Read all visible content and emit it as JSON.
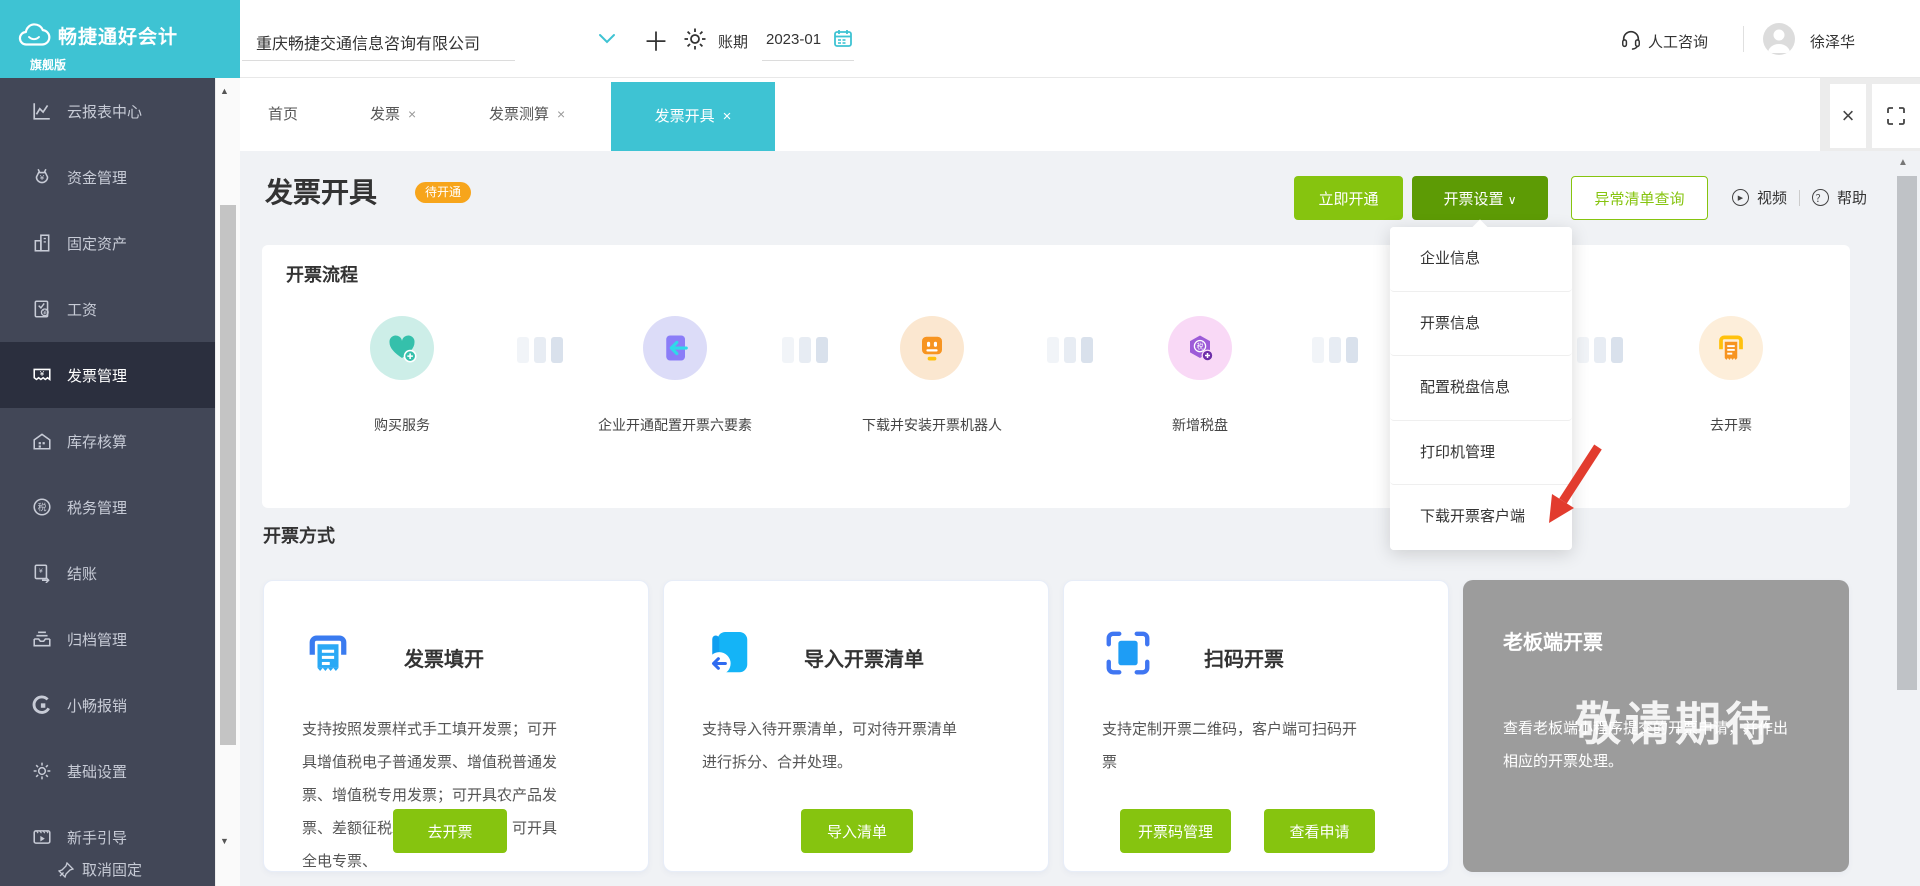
{
  "header": {
    "logo_title": "畅捷通好会计",
    "logo_subtitle": "旗舰版",
    "company": "重庆畅捷交通信息咨询有限公司",
    "period_label": "账期",
    "period_value": "2023-01",
    "support_label": "人工咨询",
    "username": "徐泽华"
  },
  "tabs": {
    "home": "首页",
    "invoice": "发票",
    "invoice_calc": "发票测算",
    "invoice_issue": "发票开具"
  },
  "page": {
    "title": "发票开具",
    "status_badge": "待开通",
    "actions": {
      "activate_now": "立即开通",
      "invoice_settings": "开票设置",
      "abnormal_list": "异常清单查询",
      "video": "视频",
      "help": "帮助"
    },
    "settings_menu": [
      "企业信息",
      "开票信息",
      "配置税盘信息",
      "打印机管理",
      "下载开票客户端"
    ]
  },
  "flow": {
    "heading": "开票流程",
    "steps": [
      "购买服务",
      "企业开通配置开票六要素",
      "下载并安装开票机器人",
      "新增税盘",
      "去开票"
    ]
  },
  "methods": {
    "heading": "开票方式",
    "cards": [
      {
        "title": "发票填开",
        "desc": "支持按照发票样式手工填开发票；可开具增值税电子普通发票、增值税普通发票、增值税专用发票；可开具农产品发票、差额征税发票、折扣发票；可开具全电专票、",
        "button": "去开票"
      },
      {
        "title": "导入开票清单",
        "desc": "支持导入待开票清单，可对待开票清单进行拆分、合并处理。",
        "button": "导入清单"
      },
      {
        "title": "扫码开票",
        "desc": "支持定制开票二维码，客户端可扫码开票",
        "buttons": [
          "开票码管理",
          "查看申请"
        ]
      },
      {
        "title": "老板端开票",
        "desc": "查看老板端小程序提交的开票申请，并作出相应的开票处理。",
        "watermark": "敬请期待"
      }
    ]
  },
  "sidebar": {
    "items": [
      "云报表中心",
      "资金管理",
      "固定资产",
      "工资",
      "发票管理",
      "库存核算",
      "税务管理",
      "结账",
      "归档管理",
      "小畅报销",
      "基础设置",
      "新手引导"
    ],
    "active_item": "发票管理",
    "unpin_label": "取消固定"
  },
  "glyphs": {
    "close": "×",
    "plus": "＋",
    "chevron_down": "∨",
    "up_arrow": "▲",
    "down_arrow": "▼",
    "help_mark": "？",
    "play": "▶"
  },
  "colors": {
    "accent_cyan": "#3ec3d3",
    "green": "#86c40f",
    "dark_green": "#5d9b05",
    "badge_orange": "#f7a51b",
    "sidebar_bg": "#424757",
    "arrow_red": "#e23c2e"
  }
}
